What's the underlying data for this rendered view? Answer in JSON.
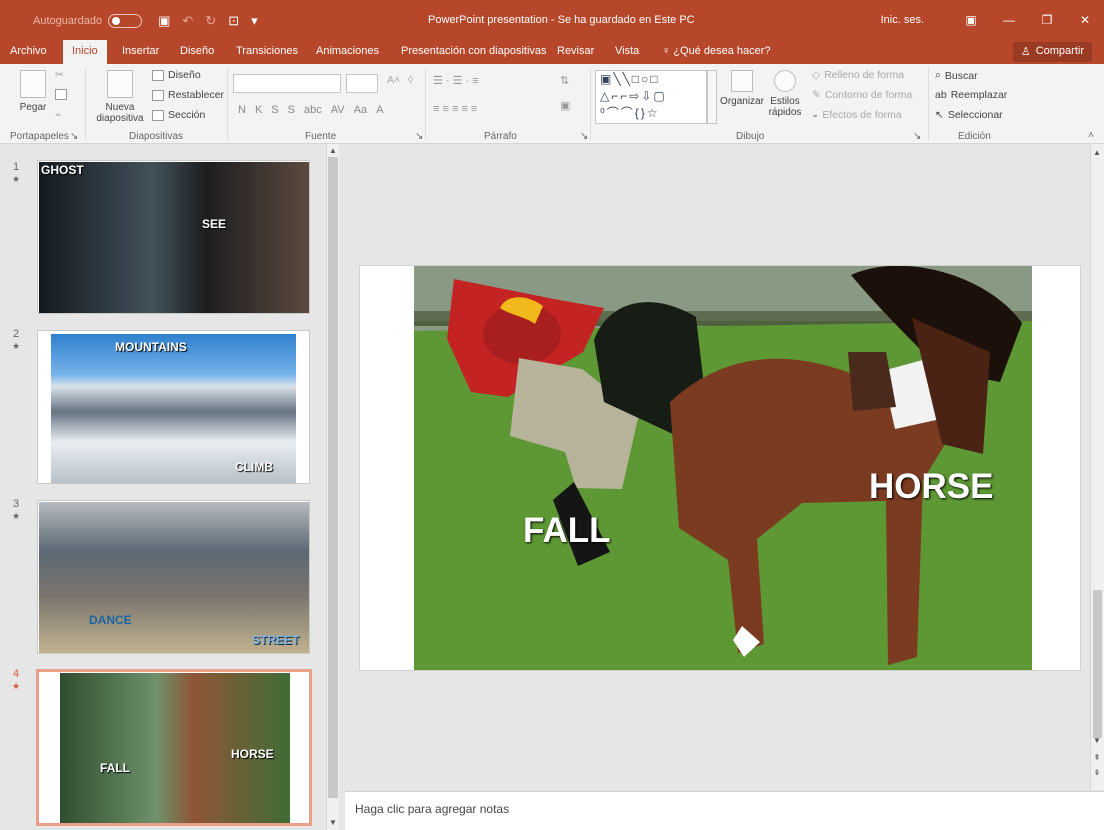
{
  "app": {
    "autosave": "Autoguardado",
    "title": "PowerPoint presentation - Se ha guardado en Este PC",
    "signin": "Inic. ses."
  },
  "tabs": [
    "Archivo",
    "Inicio",
    "Insertar",
    "Diseño",
    "Transiciones",
    "Animaciones",
    "Presentación con diapositivas",
    "Revisar",
    "Vista"
  ],
  "tell_me": "¿Qué desea hacer?",
  "share": "Compartir",
  "ribbon": {
    "clipboard": {
      "paste": "Pegar",
      "group": "Portapapeles"
    },
    "slides": {
      "new_slide_line1": "Nueva",
      "new_slide_line2": "diapositiva",
      "layout": "Diseño",
      "reset": "Restablecer",
      "section": "Sección",
      "group": "Diapositivas"
    },
    "font": {
      "group": "Fuente"
    },
    "paragraph": {
      "group": "Párrafo"
    },
    "drawing": {
      "arrange": "Organizar",
      "quick_styles_line1": "Estilos",
      "quick_styles_line2": "rápidos",
      "fill": "Relleno de forma",
      "outline": "Contorno de forma",
      "effects": "Efectos de forma",
      "group": "Dibujo"
    },
    "editing": {
      "find": "Buscar",
      "replace": "Reemplazar",
      "select": "Seleccionar",
      "group": "Edición"
    }
  },
  "slides": [
    {
      "number": "1",
      "labels": [
        "GHOST",
        "SEE"
      ]
    },
    {
      "number": "2",
      "labels": [
        "MOUNTAINS",
        "CLIMB"
      ]
    },
    {
      "number": "3",
      "labels": [
        "DANCE",
        "STREET"
      ]
    },
    {
      "number": "4",
      "labels": [
        "FALL",
        "HORSE"
      ]
    }
  ],
  "current_slide": {
    "labels": [
      "FALL",
      "HORSE"
    ]
  },
  "notes": "Haga clic para agregar notas"
}
